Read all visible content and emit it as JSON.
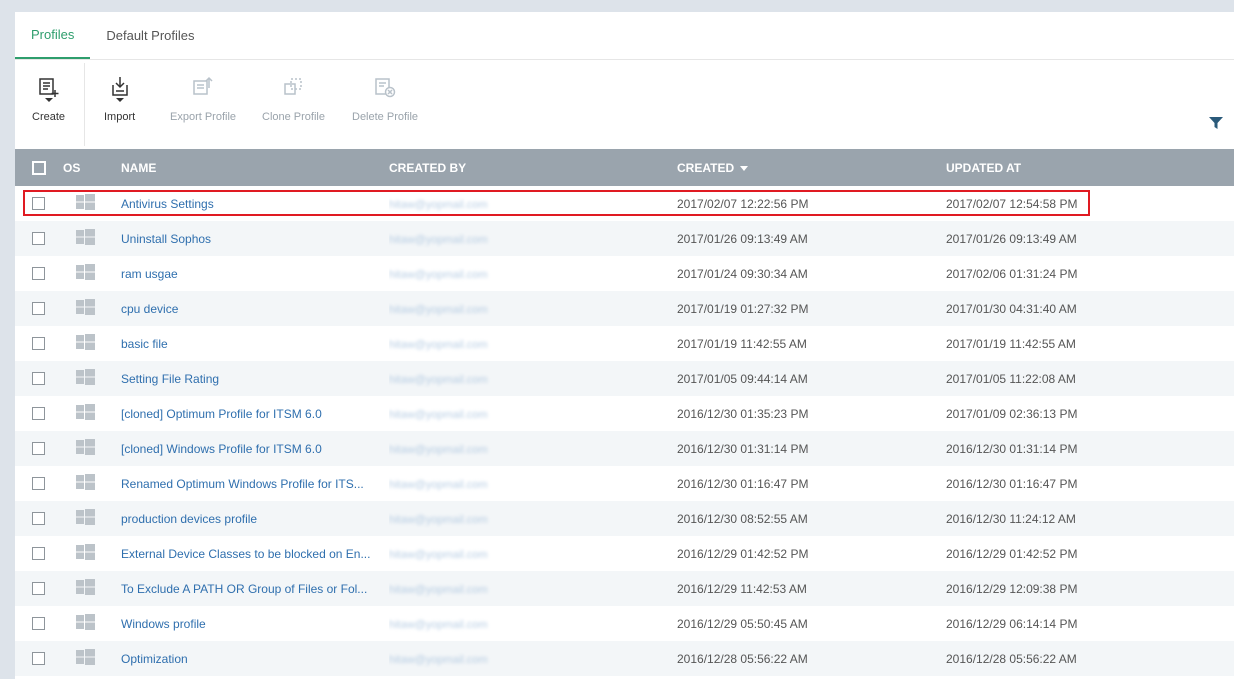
{
  "tabs": [
    {
      "label": "Profiles",
      "active": true
    },
    {
      "label": "Default Profiles",
      "active": false
    }
  ],
  "toolbar": {
    "create": "Create",
    "import": "Import",
    "export": "Export Profile",
    "clone": "Clone Profile",
    "delete": "Delete Profile"
  },
  "columns": {
    "os": "OS",
    "name": "NAME",
    "created_by": "CREATED BY",
    "created": "CREATED",
    "updated": "UPDATED AT"
  },
  "colors": {
    "accent": "#2e9e6d",
    "link": "#2f6fae",
    "header_bg": "#9aa4ad",
    "highlight": "#e01a22"
  },
  "rows": [
    {
      "name": "Antivirus Settings",
      "created_by": "hitaw@yopmail.com",
      "created": "2017/02/07 12:22:56 PM",
      "updated": "2017/02/07 12:54:58 PM"
    },
    {
      "name": "Uninstall Sophos",
      "created_by": "hitaw@yopmail.com",
      "created": "2017/01/26 09:13:49 AM",
      "updated": "2017/01/26 09:13:49 AM"
    },
    {
      "name": "ram usgae",
      "created_by": "hitaw@yopmail.com",
      "created": "2017/01/24 09:30:34 AM",
      "updated": "2017/02/06 01:31:24 PM"
    },
    {
      "name": "cpu device",
      "created_by": "hitaw@yopmail.com",
      "created": "2017/01/19 01:27:32 PM",
      "updated": "2017/01/30 04:31:40 AM"
    },
    {
      "name": "basic file",
      "created_by": "hitaw@yopmail.com",
      "created": "2017/01/19 11:42:55 AM",
      "updated": "2017/01/19 11:42:55 AM"
    },
    {
      "name": "Setting File Rating",
      "created_by": "hitaw@yopmail.com",
      "created": "2017/01/05 09:44:14 AM",
      "updated": "2017/01/05 11:22:08 AM"
    },
    {
      "name": "[cloned] Optimum Profile for ITSM 6.0",
      "created_by": "hitaw@yopmail.com",
      "created": "2016/12/30 01:35:23 PM",
      "updated": "2017/01/09 02:36:13 PM"
    },
    {
      "name": "[cloned] Windows Profile for ITSM 6.0",
      "created_by": "hitaw@yopmail.com",
      "created": "2016/12/30 01:31:14 PM",
      "updated": "2016/12/30 01:31:14 PM"
    },
    {
      "name": "Renamed Optimum Windows Profile for ITS...",
      "created_by": "hitaw@yopmail.com",
      "created": "2016/12/30 01:16:47 PM",
      "updated": "2016/12/30 01:16:47 PM"
    },
    {
      "name": "production devices profile",
      "created_by": "hitaw@yopmail.com",
      "created": "2016/12/30 08:52:55 AM",
      "updated": "2016/12/30 11:24:12 AM"
    },
    {
      "name": "External Device Classes to be blocked on En...",
      "created_by": "hitaw@yopmail.com",
      "created": "2016/12/29 01:42:52 PM",
      "updated": "2016/12/29 01:42:52 PM"
    },
    {
      "name": "To Exclude A PATH OR Group of Files or Fol...",
      "created_by": "hitaw@yopmail.com",
      "created": "2016/12/29 11:42:53 AM",
      "updated": "2016/12/29 12:09:38 PM"
    },
    {
      "name": "Windows profile",
      "created_by": "hitaw@yopmail.com",
      "created": "2016/12/29 05:50:45 AM",
      "updated": "2016/12/29 06:14:14 PM"
    },
    {
      "name": "Optimization",
      "created_by": "hitaw@yopmail.com",
      "created": "2016/12/28 05:56:22 AM",
      "updated": "2016/12/28 05:56:22 AM"
    }
  ]
}
